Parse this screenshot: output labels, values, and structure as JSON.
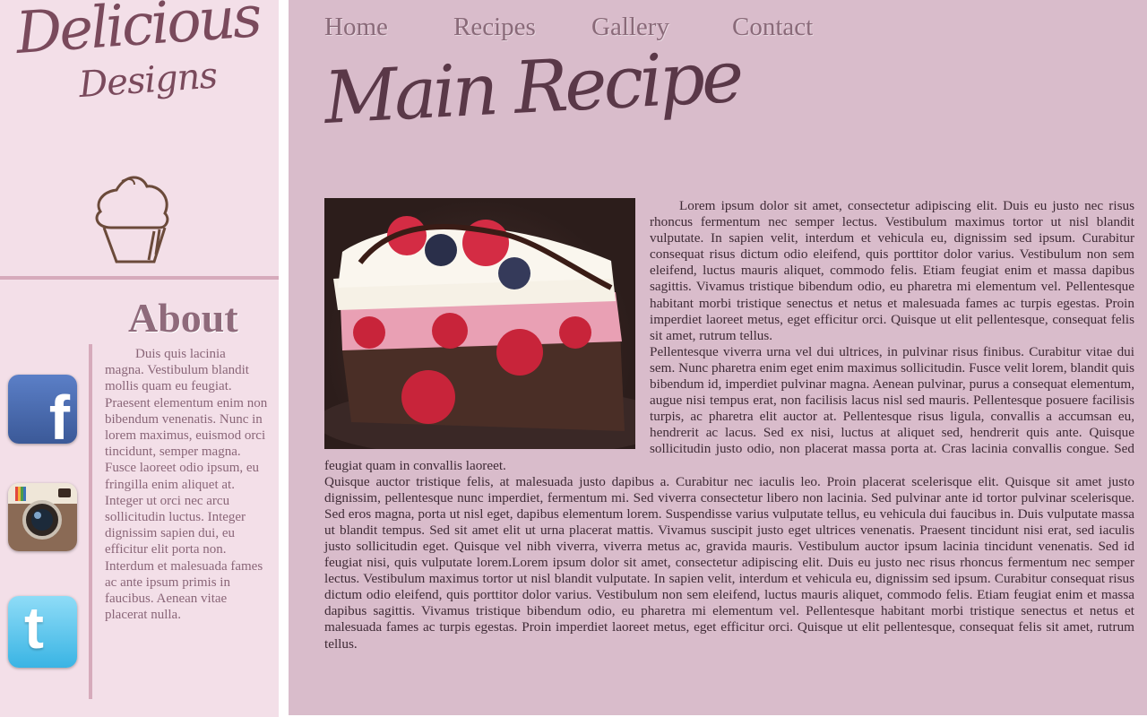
{
  "sidebar": {
    "logo": {
      "line1": "Delicious",
      "line2": "Designs",
      "icon": "cupcake-icon"
    },
    "about": {
      "title": "About",
      "text": "Duis quis lacinia magna. Vestibulum blandit mollis quam eu feugiat. Praesent elementum enim non bibendum venenatis. Nunc in lorem maximus, euismod orci tincidunt, semper magna. Fusce laoreet odio ipsum, eu fringilla enim aliquet at. Integer ut orci nec arcu sollicitudin luctus. Integer dignissim sapien dui, eu efficitur elit porta non. Interdum et malesuada fames ac ante ipsum primis in faucibus. Aenean vitae placerat nulla."
    },
    "social": [
      {
        "icon": "facebook-icon",
        "glyph": "f"
      },
      {
        "icon": "instagram-icon"
      },
      {
        "icon": "twitter-icon",
        "glyph": "t"
      }
    ]
  },
  "nav": {
    "items": [
      {
        "label": "Home"
      },
      {
        "label": "Recipes"
      },
      {
        "label": "Gallery"
      },
      {
        "label": "Contact"
      }
    ]
  },
  "main": {
    "title": "Main Recipe",
    "image": {
      "icon": "cake-slice-photo"
    },
    "paragraphs": [
      "Lorem ipsum dolor sit amet, consectetur adipiscing elit. Duis eu justo nec risus rhoncus fermentum nec semper lectus. Vestibulum maximus tortor ut nisl blandit vulputate. In sapien velit, interdum et vehicula eu, dignissim sed ipsum. Curabitur consequat risus dictum odio eleifend, quis porttitor dolor varius. Vestibulum non sem eleifend, luctus mauris aliquet, commodo felis. Etiam feugiat enim et massa dapibus sagittis. Vivamus tristique bibendum odio, eu pharetra mi elementum vel. Pellentesque habitant morbi tristique senectus et netus et malesuada fames ac turpis egestas. Proin imperdiet laoreet metus, eget efficitur orci. Quisque ut elit pellentesque, consequat felis sit amet, rutrum tellus.",
      "Pellentesque viverra urna vel dui ultrices, in pulvinar risus finibus. Curabitur vitae dui sem. Nunc pharetra enim eget enim maximus sollicitudin. Fusce velit lorem, blandit quis bibendum id, imperdiet pulvinar magna. Aenean pulvinar, purus a consequat elementum, augue nisi tempus erat, non facilisis lacus nisl sed mauris. Pellentesque posuere facilisis turpis, ac pharetra elit auctor at. Pellentesque risus ligula, convallis a accumsan eu, hendrerit ac lacus. Sed ex nisi, luctus at aliquet sed, hendrerit quis ante. Quisque sollicitudin justo odio, non placerat massa porta at. Cras lacinia convallis congue. Sed feugiat quam in convallis laoreet.",
      "Quisque auctor tristique felis, at malesuada justo dapibus a. Curabitur nec iaculis leo. Proin placerat scelerisque elit. Quisque sit amet justo dignissim, pellentesque nunc imperdiet, fermentum mi. Sed viverra consectetur libero non lacinia. Sed pulvinar ante id tortor pulvinar scelerisque. Sed eros magna, porta ut nisl eget, dapibus elementum lorem. Suspendisse varius vulputate tellus, eu vehicula dui faucibus in. Duis vulputate massa ut blandit tempus. Sed sit amet elit ut urna placerat mattis. Vivamus suscipit justo eget ultrices venenatis. Praesent tincidunt nisi erat, sed iaculis justo sollicitudin eget. Quisque vel nibh viverra, viverra metus ac, gravida mauris. Vestibulum auctor ipsum lacinia tincidunt venenatis. Sed id feugiat nisi, quis vulputate lorem.Lorem ipsum dolor sit amet, consectetur adipiscing elit. Duis eu justo nec risus rhoncus fermentum nec semper lectus. Vestibulum maximus tortor ut nisl blandit vulputate. In sapien velit, interdum et vehicula eu, dignissim sed ipsum. Curabitur consequat risus dictum odio eleifend, quis porttitor dolor varius. Vestibulum non sem eleifend, luctus mauris aliquet, commodo felis. Etiam feugiat enim et massa dapibus sagittis. Vivamus tristique bibendum odio, eu pharetra mi elementum vel. Pellentesque habitant morbi tristique senectus et netus et malesuada fames ac turpis egestas. Proin imperdiet laoreet metus, eget efficitur orci. Quisque ut elit pellentesque, consequat felis sit amet, rutrum tellus."
    ]
  },
  "colors": {
    "sidebar_bg": "#f3dfe8",
    "main_bg": "#d9bccb",
    "accent_rule": "#d6aabb",
    "nav_text": "#8a6a79",
    "title_text": "#5a3848"
  }
}
